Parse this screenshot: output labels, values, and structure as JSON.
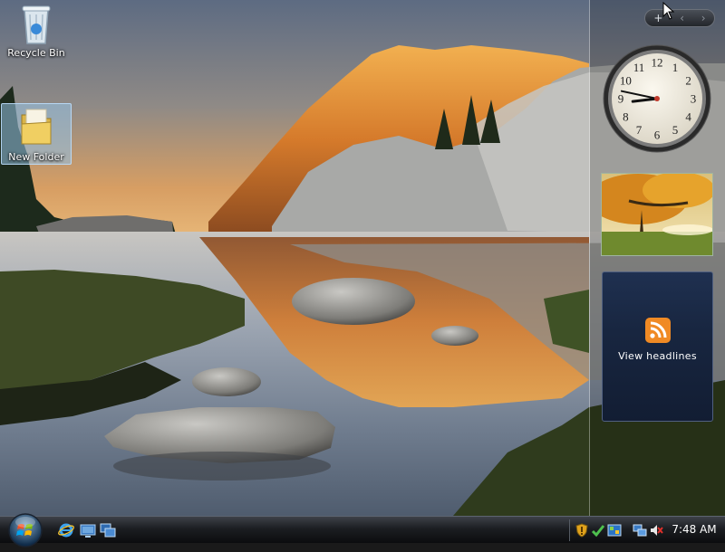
{
  "desktop": {
    "icons": [
      {
        "label": "Recycle Bin"
      },
      {
        "label": "New Folder"
      }
    ]
  },
  "sidebar": {
    "controls": {
      "add": "+",
      "prev": "‹",
      "next": "›"
    },
    "clock": {
      "hour": 8,
      "minute": 47
    },
    "feed": {
      "label": "View headlines"
    }
  },
  "taskbar": {
    "start_icon": "windows-orb-icon",
    "quick_launch": [
      "internet-explorer-icon",
      "show-desktop-icon",
      "switch-windows-icon"
    ],
    "tray_icons": [
      "windows-defender-icon",
      "security-center-icon",
      "network-alt-icon",
      "network-icon",
      "volume-muted-icon"
    ],
    "time": "7:48 AM"
  },
  "colors": {
    "taskbar_top": "#3d4148",
    "taskbar_bottom": "#0b0c0e",
    "sky_top": "#5d6b82",
    "sky_horizon": "#e0a86a",
    "mountain_lit": "#e38a32",
    "feed_gadget_bg": "#1f3050",
    "rss_orange": "#f08a24"
  }
}
